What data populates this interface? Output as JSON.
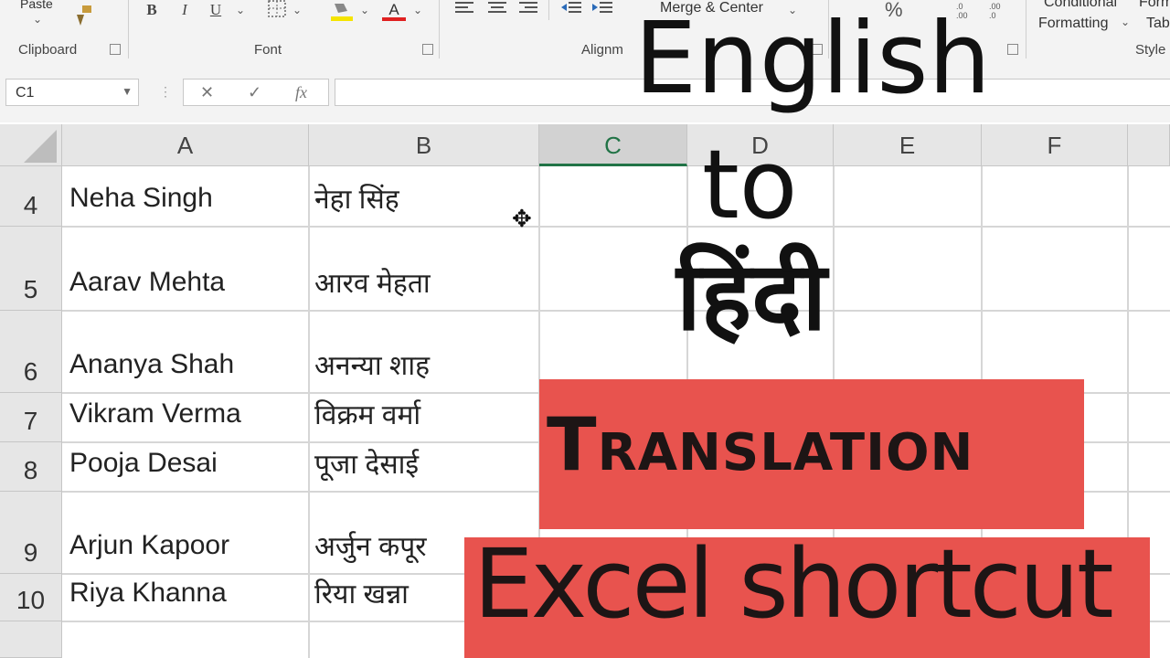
{
  "ribbon": {
    "clipboard": {
      "paste": "Paste",
      "label": "Clipboard"
    },
    "font": {
      "label": "Font",
      "bold": "B",
      "italic": "I",
      "underline": "U",
      "font_color": "A"
    },
    "alignment": {
      "label": "Alignm",
      "merge_center": "Merge & Center"
    },
    "number": {
      "percent": "%"
    },
    "styles": {
      "conditional_line1": "Conditional",
      "conditional_line2": "Formatting",
      "format_line1": "Form",
      "format_line2": "Tab",
      "label": "Style"
    }
  },
  "formula_bar": {
    "name_box": "C1",
    "cancel": "✕",
    "enter": "✓",
    "fx": "fx"
  },
  "columns": [
    "A",
    "B",
    "C",
    "D",
    "E",
    "F"
  ],
  "selected_column": "C",
  "rows": [
    {
      "num": "4",
      "a": "Neha Singh",
      "b": "नेहा सिंह"
    },
    {
      "num": "5",
      "a": "Aarav Mehta",
      "b": "आरव मेहता"
    },
    {
      "num": "6",
      "a": "Ananya Shah",
      "b": "अनन्या शाह"
    },
    {
      "num": "7",
      "a": "Vikram Verma",
      "b": "विक्रम वर्मा"
    },
    {
      "num": "8",
      "a": "Pooja Desai",
      "b": "पूजा देसाई"
    },
    {
      "num": "9",
      "a": "Arjun Kapoor",
      "b": "अर्जुन कपूर"
    },
    {
      "num": "10",
      "a": "Riya Khanna",
      "b": "रिया खन्ना"
    }
  ],
  "overlay": {
    "line1": "English",
    "line2": "to",
    "line3": "हिंदी",
    "banner1": "Translation",
    "banner2": "Excel  shortcut"
  },
  "colors": {
    "banner": "#e8534e",
    "selected_column_accent": "#217346"
  }
}
